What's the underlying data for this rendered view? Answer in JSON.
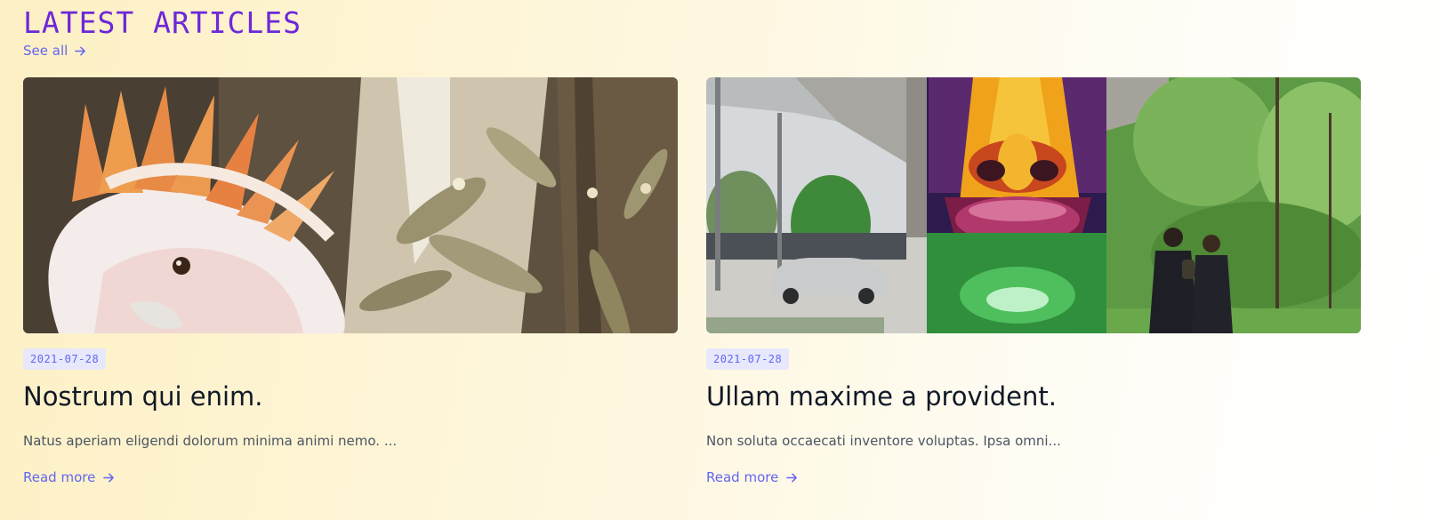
{
  "section": {
    "heading": "LATEST ARTICLES",
    "see_all": "See all"
  },
  "articles": [
    {
      "date": "2021-07-28",
      "title": "Nostrum qui enim.",
      "excerpt": "Natus aperiam eligendi dolorum minima animi nemo. ...",
      "read_more": "Read more",
      "image": "cockatoo-illustration"
    },
    {
      "date": "2021-07-28",
      "title": "Ullam maxime a provident.",
      "excerpt": "Non soluta occaecati inventore voluptas. Ipsa omni...",
      "read_more": "Read more",
      "image": "street-mural-triptych"
    }
  ],
  "icons": {
    "see_all": "arrow-right-icon",
    "read_more": "arrow-right-icon"
  },
  "colors": {
    "heading": "#6d28d9",
    "link": "#6366f1",
    "date_badge_bg": "#e7e8fb",
    "title": "#111827",
    "excerpt": "#4b5563"
  }
}
